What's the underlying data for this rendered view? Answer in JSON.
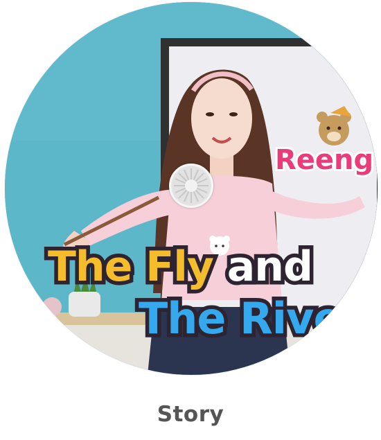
{
  "card": {
    "title": {
      "line1_a": "The Fly",
      "line1_b": " and",
      "line2": "The River"
    },
    "brand_logo": "Reeng",
    "label": "Story"
  },
  "colors": {
    "wall": "#5cb7c9",
    "title_yellow": "#f5bd2b",
    "title_blue": "#35a9ee",
    "title_outline": "#2e2330",
    "brand_pink": "#ea3c7a",
    "label_gray": "#555555"
  },
  "icons": {
    "disc_hub": "cd-hub-icon",
    "mascot": "bear-mascot-icon"
  }
}
